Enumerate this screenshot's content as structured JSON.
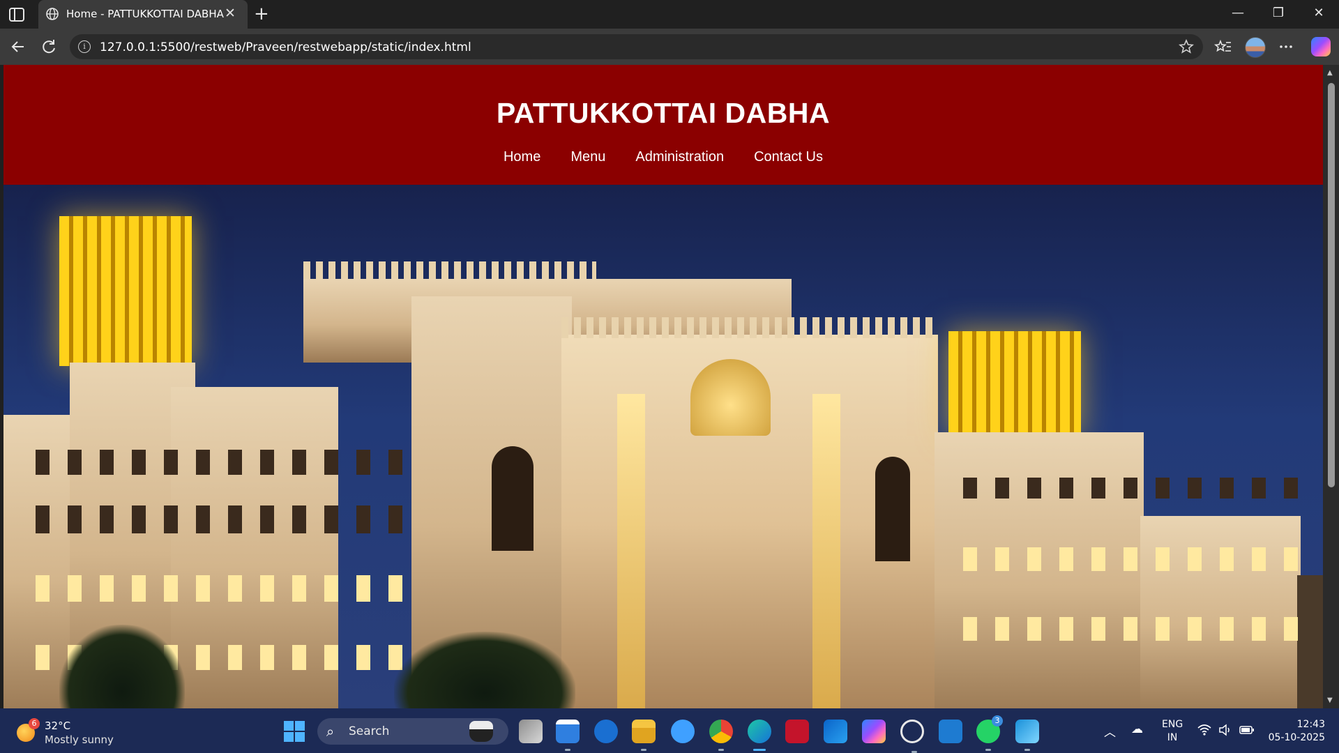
{
  "browser": {
    "tab": {
      "title": "Home - PATTUKKOTTAI DABHA",
      "close_glyph": "✕"
    },
    "new_tab_glyph": "+",
    "window": {
      "minimize": "—",
      "restore": "❐",
      "close": "✕"
    },
    "address": {
      "url": "127.0.0.1:5500/restweb/Praveen/restwebapp/static/index.html",
      "info_glyph": "i"
    },
    "icons": [
      "sidebar-icon",
      "globe-icon",
      "back-icon",
      "refresh-icon",
      "favorite-star-icon",
      "favorites-icon",
      "more-icon",
      "copilot-icon"
    ]
  },
  "site": {
    "title": "PATTUKKOTTAI DABHA",
    "nav": [
      {
        "label": "Home"
      },
      {
        "label": "Menu"
      },
      {
        "label": "Administration"
      },
      {
        "label": "Contact Us"
      }
    ],
    "header_color": "#8b0000"
  },
  "taskbar": {
    "weather": {
      "badge": "6",
      "temp": "32°C",
      "condition": "Mostly sunny"
    },
    "search_placeholder": "Search",
    "app_badges": {
      "edge_dev": "",
      "whatsapp": "3"
    },
    "language": {
      "line1": "ENG",
      "line2": "IN"
    },
    "clock": {
      "time": "12:43",
      "date": "05-10-2025"
    }
  }
}
